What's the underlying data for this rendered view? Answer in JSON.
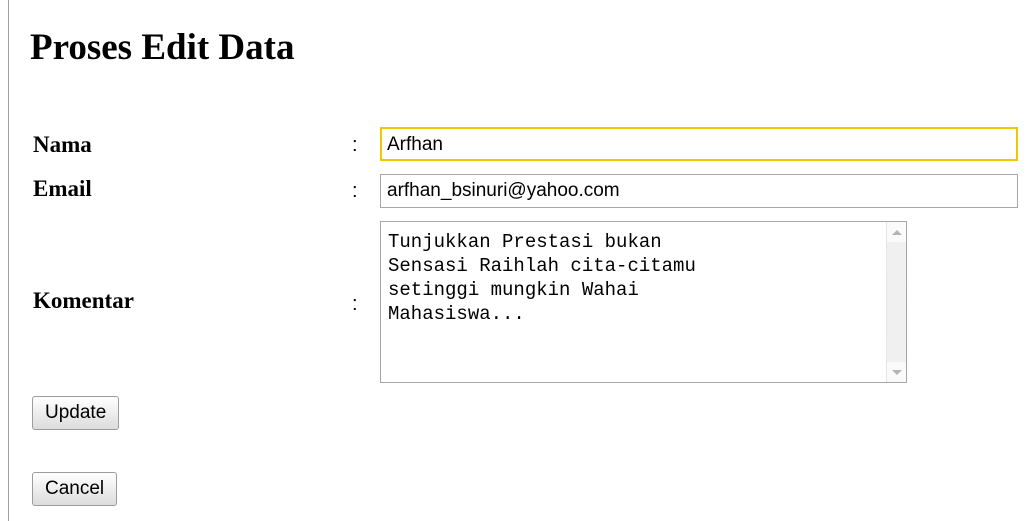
{
  "page": {
    "title": "Proses Edit Data"
  },
  "form": {
    "colon": ":",
    "nama": {
      "label": "Nama",
      "value": "Arfhan"
    },
    "email": {
      "label": "Email",
      "value": "arfhan_bsinuri@yahoo.com"
    },
    "komentar": {
      "label": "Komentar",
      "value": "Tunjukkan Prestasi bukan\nSensasi Raihlah cita-citamu\nsetinggi mungkin Wahai\nMahasiswa..."
    },
    "update_label": "Update",
    "cancel_label": "Cancel"
  },
  "colors": {
    "focus_border": "#f0c800",
    "input_border": "#a7a7a7"
  }
}
